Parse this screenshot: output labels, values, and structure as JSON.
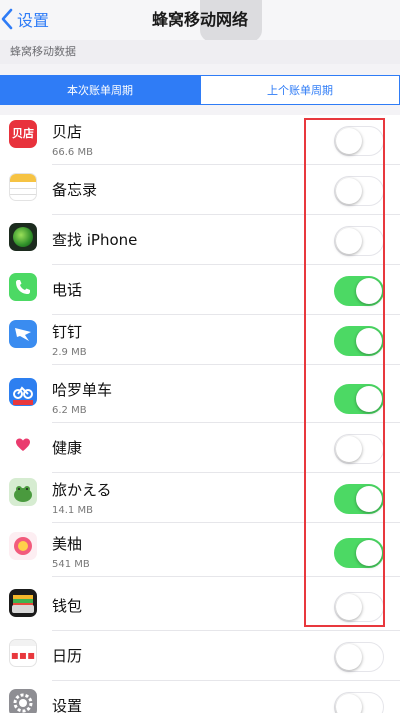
{
  "nav": {
    "back_label": "设置",
    "title": "蜂窝移动网络"
  },
  "section_header": "蜂窝移动数据",
  "tabs": [
    {
      "label": "本次账单周期",
      "active": true
    },
    {
      "label": "上个账单周期",
      "active": false
    }
  ],
  "apps": [
    {
      "name": "贝店",
      "usage": "66.6 MB",
      "enabled": false,
      "icon": "beidian-app-icon"
    },
    {
      "name": "备忘录",
      "usage": "",
      "enabled": false,
      "icon": "notes-app-icon"
    },
    {
      "name": "查找 iPhone",
      "usage": "",
      "enabled": false,
      "icon": "find-iphone-app-icon"
    },
    {
      "name": "电话",
      "usage": "",
      "enabled": true,
      "icon": "phone-app-icon"
    },
    {
      "name": "钉钉",
      "usage": "2.9 MB",
      "enabled": true,
      "icon": "dingtalk-app-icon"
    },
    {
      "name": "哈罗单车",
      "usage": "6.2 MB",
      "enabled": true,
      "icon": "hellobike-app-icon"
    },
    {
      "name": "健康",
      "usage": "",
      "enabled": false,
      "icon": "health-app-icon"
    },
    {
      "name": "旅かえる",
      "usage": "14.1 MB",
      "enabled": true,
      "icon": "tabikaeru-app-icon"
    },
    {
      "name": "美柚",
      "usage": "541 MB",
      "enabled": true,
      "icon": "meiyou-app-icon"
    },
    {
      "name": "钱包",
      "usage": "",
      "enabled": false,
      "icon": "wallet-app-icon"
    },
    {
      "name": "日历",
      "usage": "",
      "enabled": false,
      "icon": "calendar-app-icon"
    },
    {
      "name": "设置",
      "usage": "",
      "enabled": false,
      "icon": "settings-app-icon"
    }
  ],
  "colors": {
    "accent": "#2f7cf6",
    "toggle_on": "#4cd964",
    "highlight": "#e8383d"
  }
}
